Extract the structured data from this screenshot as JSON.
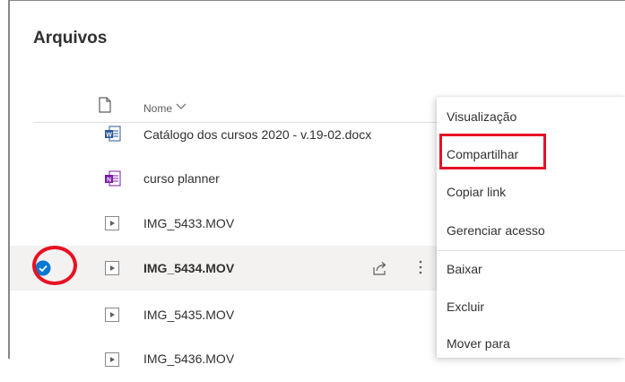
{
  "page": {
    "title": "Arquivos"
  },
  "list": {
    "column_name": "Nome",
    "files": [
      {
        "name": "Catálogo dos cursos 2020 - v.19-02.docx",
        "icon": "word-icon"
      },
      {
        "name": "curso planner",
        "icon": "onenote-icon"
      },
      {
        "name": "IMG_5433.MOV",
        "icon": "video-file-icon"
      },
      {
        "name": "IMG_5434.MOV",
        "icon": "video-file-icon",
        "selected": true
      },
      {
        "name": "IMG_5435.MOV",
        "icon": "video-file-icon"
      },
      {
        "name": "IMG_5436.MOV",
        "icon": "video-file-icon"
      }
    ]
  },
  "context_menu": {
    "items": [
      {
        "label": "Visualização"
      },
      {
        "label": "Compartilhar",
        "highlighted": true
      },
      {
        "label": "Copiar link"
      },
      {
        "label": "Gerenciar acesso"
      },
      {
        "label": "Baixar"
      },
      {
        "label": "Excluir"
      },
      {
        "label": "Mover para"
      }
    ]
  },
  "colors": {
    "accent": "#0078d4",
    "annotation_red": "#e81123",
    "word": "#2b579a",
    "onenote": "#7719aa"
  }
}
